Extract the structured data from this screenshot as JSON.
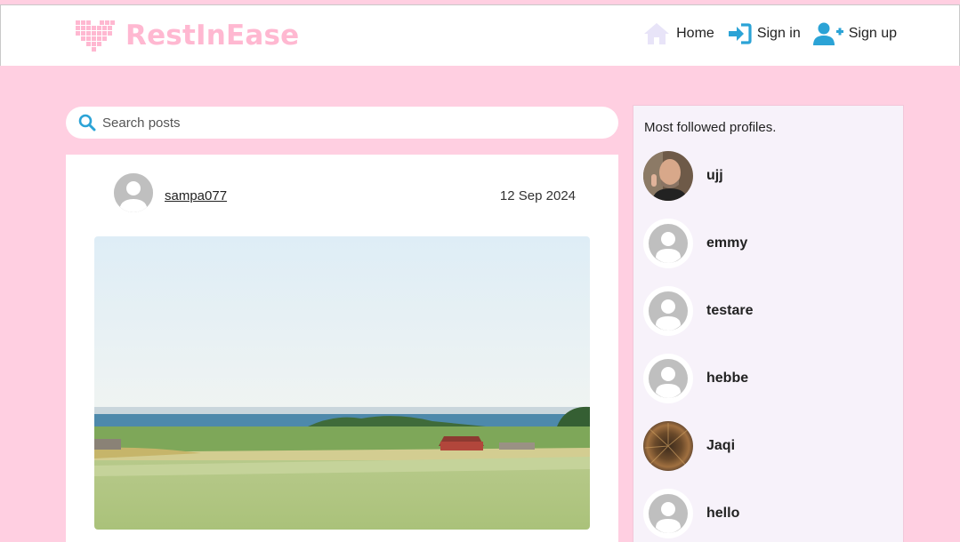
{
  "brand": {
    "name": "RestInEase",
    "color": "#ffb8d1"
  },
  "nav": {
    "items": [
      {
        "label": "Home",
        "icon": "house-icon"
      },
      {
        "label": "Sign in",
        "icon": "sign-in-icon"
      },
      {
        "label": "Sign up",
        "icon": "user-plus-icon"
      }
    ]
  },
  "search": {
    "placeholder": "Search posts",
    "icon": "search-icon"
  },
  "post": {
    "username": "sampa077",
    "date": "12 Sep 2024",
    "image_alt": "countryside-landscape"
  },
  "sidebar": {
    "title": "Most followed profiles.",
    "profiles": [
      {
        "name": "ujj",
        "avatar": "photo"
      },
      {
        "name": "emmy",
        "avatar": "default"
      },
      {
        "name": "testare",
        "avatar": "default"
      },
      {
        "name": "hebbe",
        "avatar": "default"
      },
      {
        "name": "Jaqi",
        "avatar": "photo"
      },
      {
        "name": "hello",
        "avatar": "default"
      }
    ]
  },
  "colors": {
    "page_background": "#ffcfe1",
    "accent_blue": "#2ba3d6",
    "sidebar_background": "#f7f2fa"
  }
}
